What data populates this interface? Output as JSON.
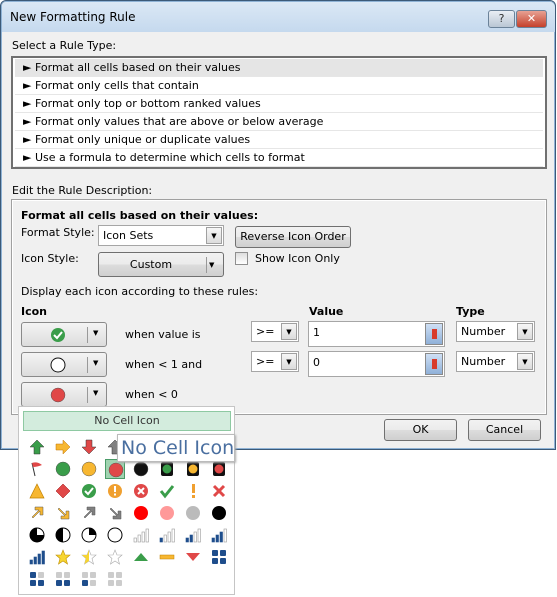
{
  "window": {
    "title": "New Formatting Rule",
    "help_label": "?",
    "close_label": "✕"
  },
  "rule_type": {
    "label": "Select a Rule Type:",
    "items": [
      "► Format all cells based on their values",
      "► Format only cells that contain",
      "► Format only top or bottom ranked values",
      "► Format only values that are above or below average",
      "► Format only unique or duplicate values",
      "► Use a formula to determine which cells to format"
    ],
    "selected_index": 0
  },
  "description": {
    "label": "Edit the Rule Description:",
    "heading": "Format all cells based on their values:",
    "format_style_label": "Format Style:",
    "format_style_value": "Icon Sets",
    "reverse_label": "Reverse Icon Order",
    "icon_style_label": "Icon Style:",
    "icon_style_value": "Custom",
    "show_icon_only_label": "Show Icon Only",
    "show_icon_only_checked": false,
    "display_rules_label": "Display each icon according to these rules:",
    "col_icon": "Icon",
    "col_value": "Value",
    "col_type": "Type",
    "rows": [
      {
        "icon": "green-check-circle",
        "text": "when value is",
        "operator": ">=",
        "value": "1",
        "type": "Number"
      },
      {
        "icon": "white-circle",
        "text": "when < 1 and",
        "operator": ">=",
        "value": "0",
        "type": "Number"
      },
      {
        "icon": "red-circle",
        "text": "when < 0"
      }
    ]
  },
  "buttons": {
    "ok": "OK",
    "cancel": "Cancel"
  },
  "picker": {
    "no_cell_icon": "No Cell Icon",
    "tooltip": "No Cell Icon",
    "selected": "red-circle",
    "icons": [
      [
        "green-up-arrow",
        "yellow-right-arrow",
        "red-down-arrow",
        "gray-up-arrow",
        "gray-right-arrow",
        "gray-down-arrow",
        "green-flag",
        "yellow-flag"
      ],
      [
        "red-flag",
        "green-circle",
        "yellow-circle",
        "red-circle",
        "black-circle",
        "traffic-green",
        "traffic-yellow",
        "traffic-red"
      ],
      [
        "yellow-triangle",
        "red-diamond",
        "green-check-circle",
        "yellow-exclaim-circle",
        "red-x-circle",
        "green-check",
        "yellow-exclaim",
        "red-x"
      ],
      [
        "yellow-up-right-arrow",
        "yellow-down-right-arrow",
        "gray-up-right-arrow",
        "gray-down-right-arrow",
        "red-ball",
        "pink-ball",
        "gray-ball",
        "black-ball"
      ],
      [
        "pie-3",
        "pie-2",
        "pie-1",
        "pie-0",
        "signal-0",
        "signal-1",
        "signal-2",
        "signal-3"
      ],
      [
        "signal-4",
        "star-full",
        "star-half",
        "star-empty",
        "green-triangle-up",
        "yellow-dash",
        "red-triangle-down",
        "boxes-4"
      ],
      [
        "boxes-3",
        "boxes-2",
        "boxes-1",
        "boxes-0"
      ]
    ]
  },
  "colors": {
    "selection": "#9fd3b0",
    "title_bar": "#c5d9ee",
    "close": "#c4402b"
  }
}
